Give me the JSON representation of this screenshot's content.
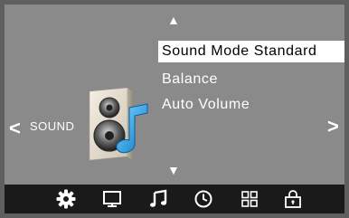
{
  "navigation": {
    "up_arrow": "▲",
    "down_arrow": "▼",
    "left_arrow": "<",
    "right_arrow": ">"
  },
  "category": {
    "label": "SOUND",
    "icon": "speaker-music-note-icon"
  },
  "menu": {
    "items": [
      {
        "label": "Sound Mode Standard",
        "selected": true
      },
      {
        "label": "Balance",
        "selected": false
      },
      {
        "label": "Auto Volume",
        "selected": false
      }
    ]
  },
  "toolbar": {
    "items": [
      {
        "icon": "gear-icon",
        "active": true
      },
      {
        "icon": "monitor-icon",
        "active": false
      },
      {
        "icon": "music-note-icon",
        "active": false
      },
      {
        "icon": "clock-icon",
        "active": false
      },
      {
        "icon": "grid-icon",
        "active": false
      },
      {
        "icon": "lock-icon",
        "active": false
      }
    ]
  },
  "colors": {
    "screen_background": "#8a8a8a",
    "bezel": "#5f5f5f",
    "toolbar_background": "#1a1a1a",
    "selection_background": "#ffffff",
    "text": "#ffffff",
    "accent_note": "#1aa7e8"
  }
}
